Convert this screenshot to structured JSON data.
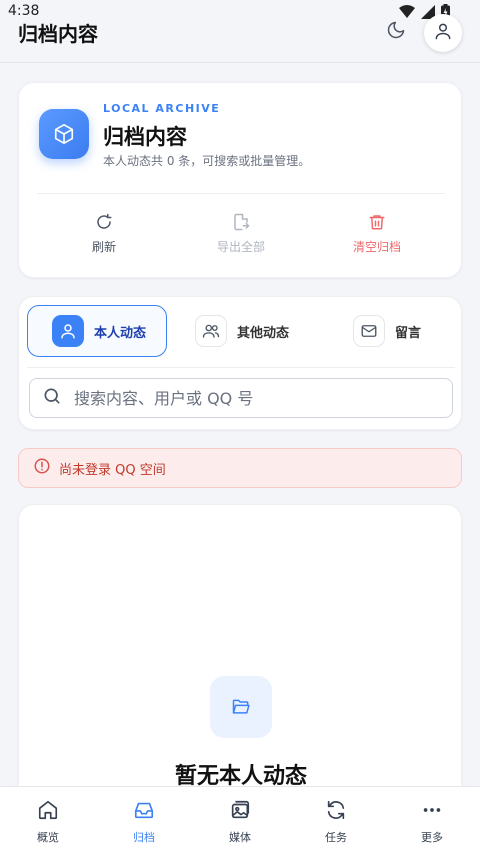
{
  "status_bar": {
    "time": "4:38"
  },
  "header": {
    "title": "归档内容"
  },
  "archive": {
    "eyebrow": "LOCAL ARCHIVE",
    "title": "归档内容",
    "description": "本人动态共 0 条，可搜索或批量管理。",
    "actions": {
      "refresh": "刷新",
      "export": "导出全部",
      "clear": "清空归档"
    }
  },
  "tabs": [
    {
      "label": "本人动态",
      "icon": "user-icon",
      "active": true
    },
    {
      "label": "其他动态",
      "icon": "users-icon",
      "active": false
    },
    {
      "label": "留言",
      "icon": "mail-icon",
      "active": false
    }
  ],
  "search": {
    "placeholder": "搜索内容、用户或 QQ 号",
    "value": ""
  },
  "alert": {
    "text": "尚未登录 QQ 空间"
  },
  "empty": {
    "title": "暂无本人动态"
  },
  "nav": [
    {
      "label": "概览",
      "icon": "home-icon",
      "active": false
    },
    {
      "label": "归档",
      "icon": "inbox-icon",
      "active": true
    },
    {
      "label": "媒体",
      "icon": "gallery-icon",
      "active": false
    },
    {
      "label": "任务",
      "icon": "sync-icon",
      "active": false
    },
    {
      "label": "更多",
      "icon": "more-icon",
      "active": false
    }
  ],
  "colors": {
    "accent": "#3b82f6",
    "danger": "#ef6a6a",
    "background": "#f3f5f9"
  }
}
